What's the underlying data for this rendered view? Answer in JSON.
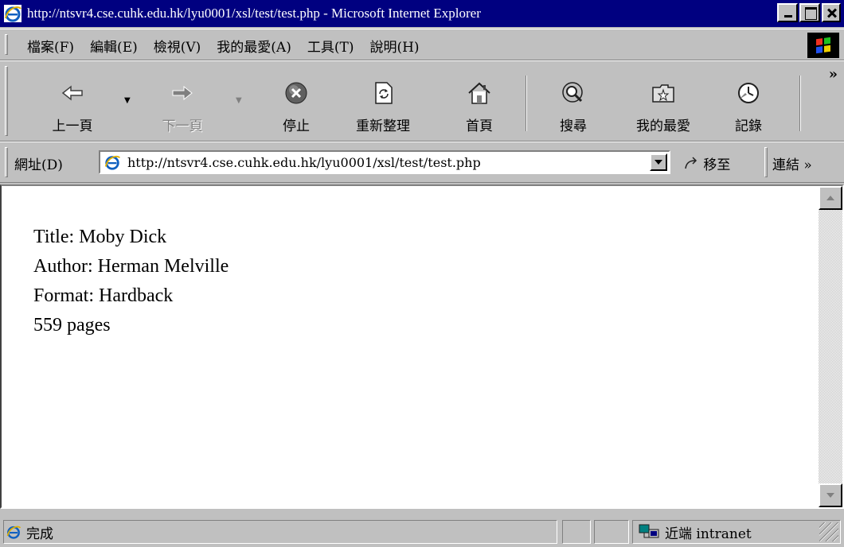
{
  "window": {
    "title": "http://ntsvr4.cse.cuhk.edu.hk/lyu0001/xsl/test/test.php - Microsoft Internet Explorer"
  },
  "menubar": {
    "items": [
      "檔案(F)",
      "編輯(E)",
      "檢視(V)",
      "我的最愛(A)",
      "工具(T)",
      "說明(H)"
    ]
  },
  "toolbar": {
    "back": "上一頁",
    "forward": "下一頁",
    "stop": "停止",
    "refresh": "重新整理",
    "home": "首頁",
    "search": "搜尋",
    "favorites": "我的最愛",
    "history": "記錄",
    "more": "»"
  },
  "addressbar": {
    "label": "網址(D)",
    "url": "http://ntsvr4.cse.cuhk.edu.hk/lyu0001/xsl/test/test.php",
    "go": "移至",
    "links": "連結 »"
  },
  "content": {
    "lines": [
      "Title: Moby Dick",
      "Author: Herman Melville",
      "Format: Hardback",
      "559 pages"
    ]
  },
  "statusbar": {
    "status": "完成",
    "zone": "近端 intranet"
  }
}
